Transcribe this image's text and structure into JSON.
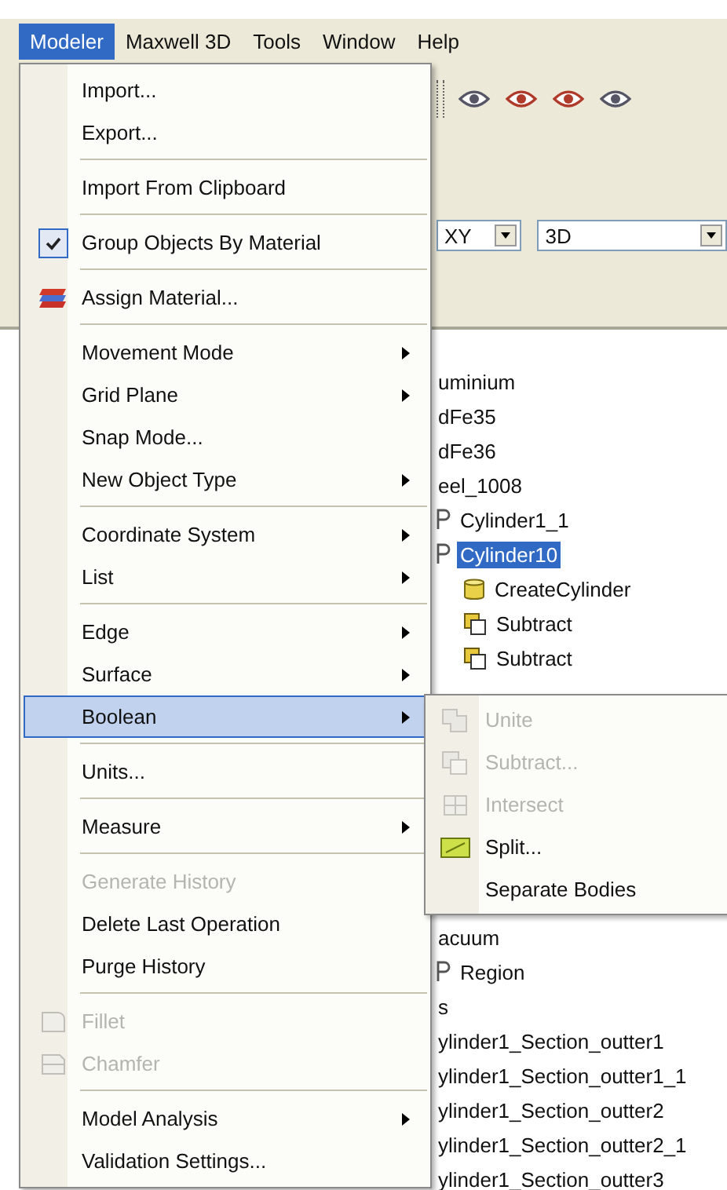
{
  "menu_bar": [
    {
      "label": "Modeler",
      "selected": true
    },
    {
      "label": "Maxwell 3D",
      "selected": false
    },
    {
      "label": "Tools",
      "selected": false
    },
    {
      "label": "Window",
      "selected": false
    },
    {
      "label": "Help",
      "selected": false
    }
  ],
  "toolbar": {
    "dropdowns": [
      {
        "value": "XY"
      },
      {
        "value": "3D"
      }
    ]
  },
  "tree": {
    "upper": [
      {
        "label": "uminium",
        "kind": "plain",
        "selected": false
      },
      {
        "label": "dFe35",
        "kind": "plain",
        "selected": false
      },
      {
        "label": "dFe36",
        "kind": "plain",
        "selected": false
      },
      {
        "label": "eel_1008",
        "kind": "plain",
        "selected": false
      },
      {
        "label": "Cylinder1_1",
        "kind": "object",
        "selected": false
      },
      {
        "label": "Cylinder10",
        "kind": "object",
        "selected": true,
        "children": [
          {
            "label": "CreateCylinder",
            "kind": "create",
            "selected": false
          },
          {
            "label": "Subtract",
            "kind": "subtract",
            "selected": false
          },
          {
            "label": "Subtract",
            "kind": "subtract",
            "selected": false
          }
        ]
      }
    ],
    "lower": [
      {
        "label": "acuum",
        "kind": "plain",
        "selected": false
      },
      {
        "label": "Region",
        "kind": "object",
        "selected": false
      },
      {
        "label": "s",
        "kind": "plain",
        "selected": false
      },
      {
        "label": "ylinder1_Section_outter1",
        "kind": "plain",
        "selected": false
      },
      {
        "label": "ylinder1_Section_outter1_1",
        "kind": "plain",
        "selected": false
      },
      {
        "label": "ylinder1_Section_outter2",
        "kind": "plain",
        "selected": false
      },
      {
        "label": "ylinder1_Section_outter2_1",
        "kind": "plain",
        "selected": false
      },
      {
        "label": "ylinder1_Section_outter3",
        "kind": "plain",
        "selected": false
      }
    ]
  },
  "modeler_menu": {
    "groups": [
      [
        {
          "label": "Import...",
          "submenu": false,
          "disabled": false,
          "checked": false,
          "selected": false
        },
        {
          "label": "Export...",
          "submenu": false,
          "disabled": false,
          "checked": false,
          "selected": false
        }
      ],
      [
        {
          "label": "Import From Clipboard",
          "submenu": false,
          "disabled": false,
          "checked": false,
          "selected": false
        }
      ],
      [
        {
          "label": "Group Objects By Material",
          "submenu": false,
          "disabled": false,
          "checked": true,
          "selected": false
        }
      ],
      [
        {
          "label": "Assign Material...",
          "kind": "material",
          "submenu": false,
          "disabled": false,
          "checked": false,
          "selected": false
        }
      ],
      [
        {
          "label": "Movement Mode",
          "submenu": true,
          "disabled": false,
          "checked": false,
          "selected": false
        },
        {
          "label": "Grid Plane",
          "submenu": true,
          "disabled": false,
          "checked": false,
          "selected": false
        },
        {
          "label": "Snap Mode...",
          "submenu": false,
          "disabled": false,
          "checked": false,
          "selected": false
        },
        {
          "label": "New Object Type",
          "submenu": true,
          "disabled": false,
          "checked": false,
          "selected": false
        }
      ],
      [
        {
          "label": "Coordinate System",
          "submenu": true,
          "disabled": false,
          "checked": false,
          "selected": false
        },
        {
          "label": "List",
          "submenu": true,
          "disabled": false,
          "checked": false,
          "selected": false
        }
      ],
      [
        {
          "label": "Edge",
          "submenu": true,
          "disabled": false,
          "checked": false,
          "selected": false
        },
        {
          "label": "Surface",
          "submenu": true,
          "disabled": false,
          "checked": false,
          "selected": false
        },
        {
          "label": "Boolean",
          "submenu": true,
          "disabled": false,
          "checked": false,
          "selected": true
        }
      ],
      [
        {
          "label": "Units...",
          "submenu": false,
          "disabled": false,
          "checked": false,
          "selected": false
        }
      ],
      [
        {
          "label": "Measure",
          "submenu": true,
          "disabled": false,
          "checked": false,
          "selected": false
        }
      ],
      [
        {
          "label": "Generate History",
          "submenu": false,
          "disabled": true,
          "checked": false,
          "selected": false
        },
        {
          "label": "Delete Last Operation",
          "submenu": false,
          "disabled": false,
          "checked": false,
          "selected": false
        },
        {
          "label": "Purge History",
          "submenu": false,
          "disabled": false,
          "checked": false,
          "selected": false
        }
      ],
      [
        {
          "label": "Fillet",
          "kind": "fillet",
          "submenu": false,
          "disabled": true,
          "checked": false,
          "selected": false
        },
        {
          "label": "Chamfer",
          "kind": "chamfer",
          "submenu": false,
          "disabled": true,
          "checked": false,
          "selected": false
        }
      ],
      [
        {
          "label": "Model Analysis",
          "submenu": true,
          "disabled": false,
          "checked": false,
          "selected": false
        },
        {
          "label": "Validation Settings...",
          "submenu": false,
          "disabled": false,
          "checked": false,
          "selected": false
        }
      ]
    ]
  },
  "boolean_submenu": [
    {
      "label": "Unite",
      "kind": "unite",
      "disabled": true
    },
    {
      "label": "Subtract...",
      "kind": "subtract",
      "disabled": true
    },
    {
      "label": "Intersect",
      "kind": "intersect",
      "disabled": true
    },
    {
      "label": "Split...",
      "kind": "split",
      "disabled": false
    },
    {
      "label": "Separate Bodies",
      "disabled": false
    }
  ]
}
